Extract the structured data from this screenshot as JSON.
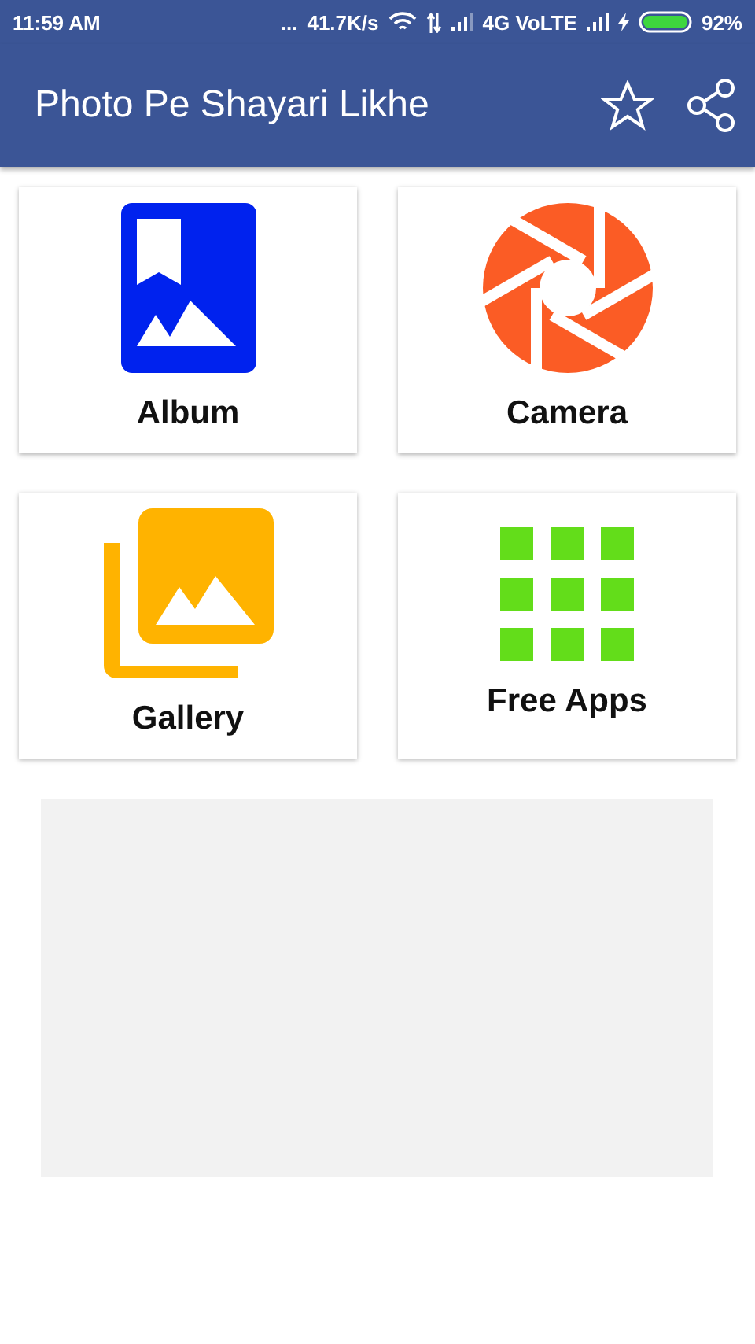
{
  "status_bar": {
    "time": "11:59 AM",
    "dots": "...",
    "speed": "41.7K/s",
    "network": "4G VoLTE",
    "battery": "92%"
  },
  "app_bar": {
    "title": "Photo Pe Shayari Likhe"
  },
  "tiles": [
    {
      "kind": "album",
      "label": "Album"
    },
    {
      "kind": "camera",
      "label": "Camera"
    },
    {
      "kind": "gallery",
      "label": "Gallery"
    },
    {
      "kind": "apps",
      "label": "Free Apps"
    }
  ]
}
